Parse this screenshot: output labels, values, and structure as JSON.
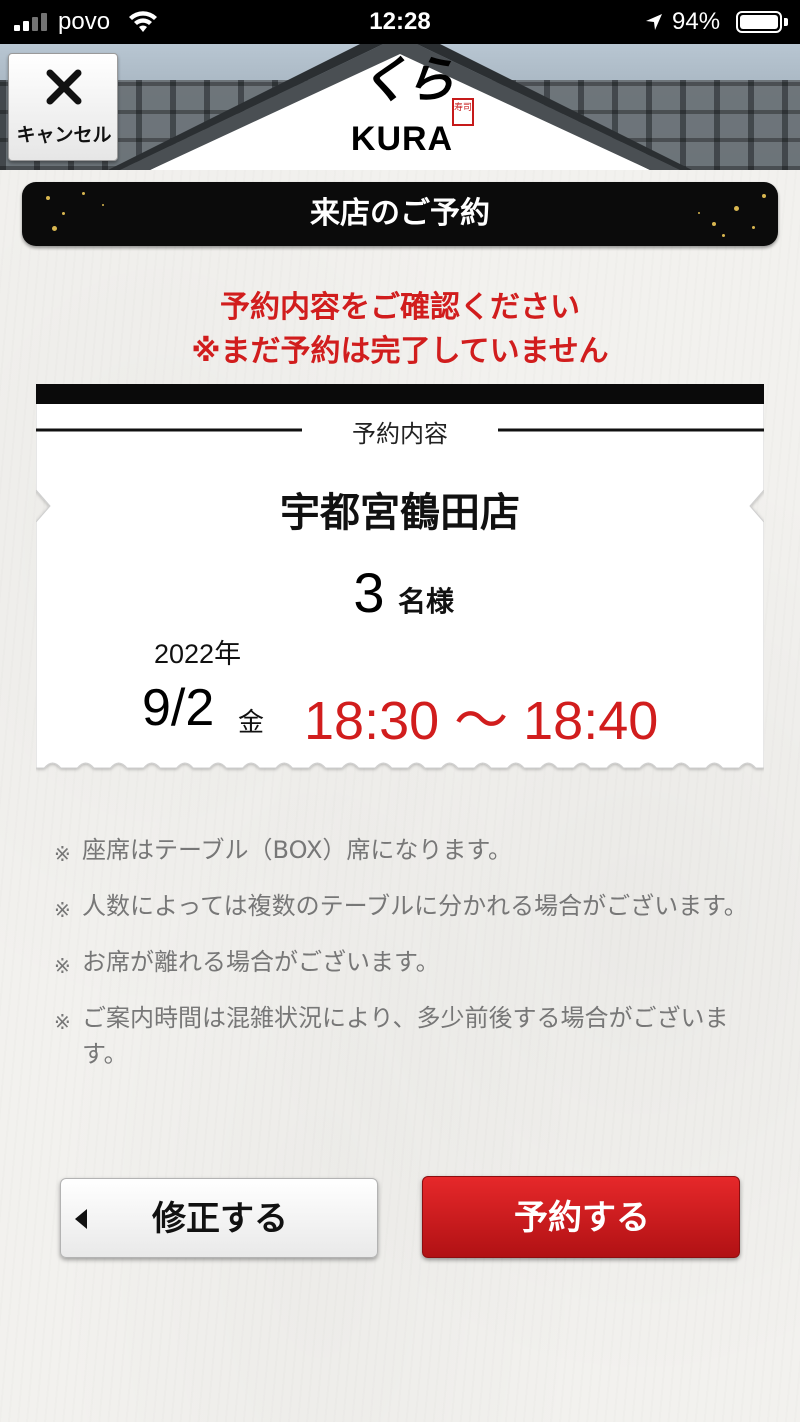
{
  "status_bar": {
    "carrier": "povo",
    "time": "12:28",
    "battery": "94%",
    "battery_level": 0.94
  },
  "header": {
    "logo_jp": "くら",
    "logo_stamp": "寿司",
    "logo_en": "KURA",
    "cancel_label": "キャンセル"
  },
  "title": "来店のご予約",
  "warning": {
    "line1": "予約内容をご確認ください",
    "line2": "※まだ予約は完了していません"
  },
  "reservation": {
    "section_label": "予約内容",
    "store": "宇都宮鶴田店",
    "party_count": "3",
    "party_unit": "名様",
    "year": "2022年",
    "date": "9/2",
    "weekday": "金",
    "time_range": "18:30 ～ 18:40"
  },
  "notes": [
    "座席はテーブル（BOX）席になります。",
    "人数によっては複数のテーブルに分かれる場合がございます。",
    "お席が離れる場合がございます。",
    "ご案内時間は混雑状況により、多少前後する場合がございます。"
  ],
  "note_mark": "※",
  "buttons": {
    "edit": "修正する",
    "reserve": "予約する"
  },
  "colors": {
    "accent_red": "#d11d1d",
    "button_red": "#c8181b",
    "banner_black": "#0b0b0b"
  }
}
